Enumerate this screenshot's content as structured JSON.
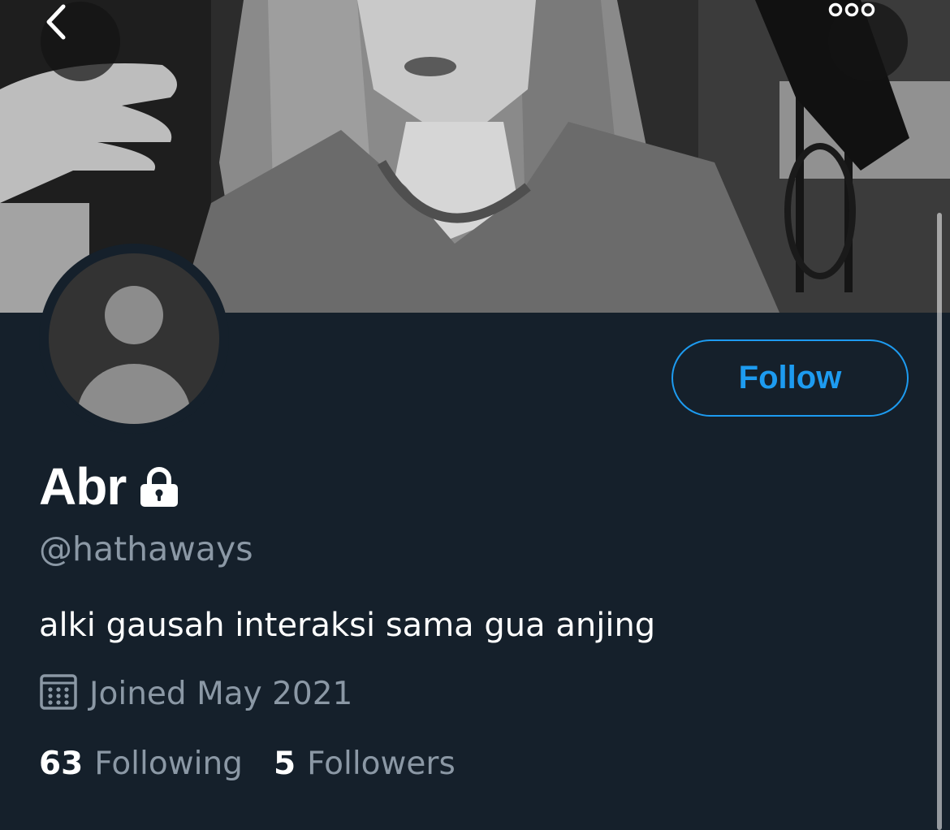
{
  "header": {
    "back_icon": "chevron-left-icon",
    "more_icon": "more-horizontal-icon"
  },
  "profile": {
    "display_name": "Abr",
    "protected_icon": "lock-icon",
    "handle": "@hathaways",
    "bio": "alki gausah interaksi sama gua anjing",
    "joined_icon": "calendar-icon",
    "joined": "Joined May 2021",
    "follow_label": "Follow",
    "following_count": "63",
    "following_label": "Following",
    "followers_count": "5",
    "followers_label": "Followers"
  },
  "colors": {
    "background": "#15202b",
    "accent": "#1d9bf0",
    "secondary_text": "#8b98a5",
    "primary_text": "#ffffff"
  }
}
